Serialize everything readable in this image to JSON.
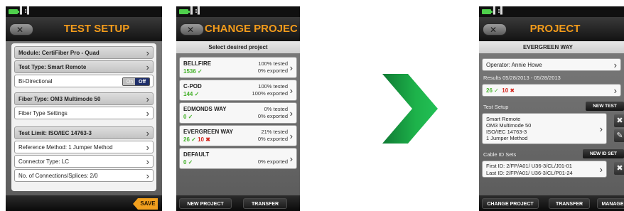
{
  "status_icons": "▌:▌",
  "back_icon_glyph": "✕",
  "chevron_glyph": "›",
  "screen1": {
    "title": "TEST SETUP",
    "module": "Module: CertiFiber Pro - Quad",
    "test_type": "Test Type: Smart Remote",
    "bidirectional_label": "Bi-Directional",
    "toggle_on": "On",
    "toggle_off": "Off",
    "fiber_type": "Fiber Type: OM3 Multimode 50",
    "fiber_type_settings": "Fiber Type Settings",
    "test_limit": "Test Limit: ISO/IEC 14763-3",
    "reference_method": "Reference Method: 1 Jumper Method",
    "connector_type": "Connector Type: LC",
    "connections_splices": "No. of Connections/Splices: 2/0",
    "save_label": "SAVE"
  },
  "screen2": {
    "title": "CHANGE PROJECT",
    "prompt": "Select desired project",
    "projects": [
      {
        "name": "BELLFIRE",
        "tested": "100% tested",
        "exported": "0% exported",
        "pass": "1536",
        "fail": ""
      },
      {
        "name": "C-POD",
        "tested": "100% tested",
        "exported": "100% exported",
        "pass": "144",
        "fail": ""
      },
      {
        "name": "EDMONDS WAY",
        "tested": "0% tested",
        "exported": "0% exported",
        "pass": "0",
        "fail": ""
      },
      {
        "name": "EVERGREEN WAY",
        "tested": "21% tested",
        "exported": "0% exported",
        "pass": "26",
        "fail": "10"
      },
      {
        "name": "DEFAULT",
        "tested": "",
        "exported": "0% exported",
        "pass": "0",
        "fail": ""
      }
    ],
    "new_project": "NEW PROJECT",
    "transfer": "TRANSFER"
  },
  "screen3": {
    "title": "PROJECT",
    "project_name": "EVERGREEN WAY",
    "operator": "Operator: Annie Howe",
    "results_range": "Results 05/28/2013 - 05/28/2013",
    "pass_count": "26",
    "fail_count": "10",
    "test_setup_label": "Test Setup",
    "new_test": "NEW TEST",
    "setup_lines": [
      "Smart Remote",
      "OM3 Multimode 50",
      "ISO/IEC 14763-3",
      "1 Jumper Method"
    ],
    "cable_id_sets_label": "Cable ID Sets",
    "new_id_set": "NEW ID SET",
    "first_id": "First ID: 2/FP/A01/ U36-3/CL/J01-01",
    "last_id": "Last ID: 2/FP/A01/ U36-3/CL/P01-24",
    "change_project": "CHANGE PROJECT",
    "transfer": "TRANSFER",
    "manage": "MANAGE"
  },
  "colors": {
    "title_orange": "#f29b1b",
    "pass_green": "#44b12a",
    "fail_red": "#d4261e",
    "arrow_green": "#1db24a",
    "toggle_off_blue": "#1f2f6a"
  },
  "icons": [
    "battery-icon",
    "status-icons",
    "back-icon",
    "chevron-right-icon",
    "check-icon",
    "fail-x-icon",
    "arrow-right-icon",
    "delete-icon",
    "edit-icon"
  ]
}
